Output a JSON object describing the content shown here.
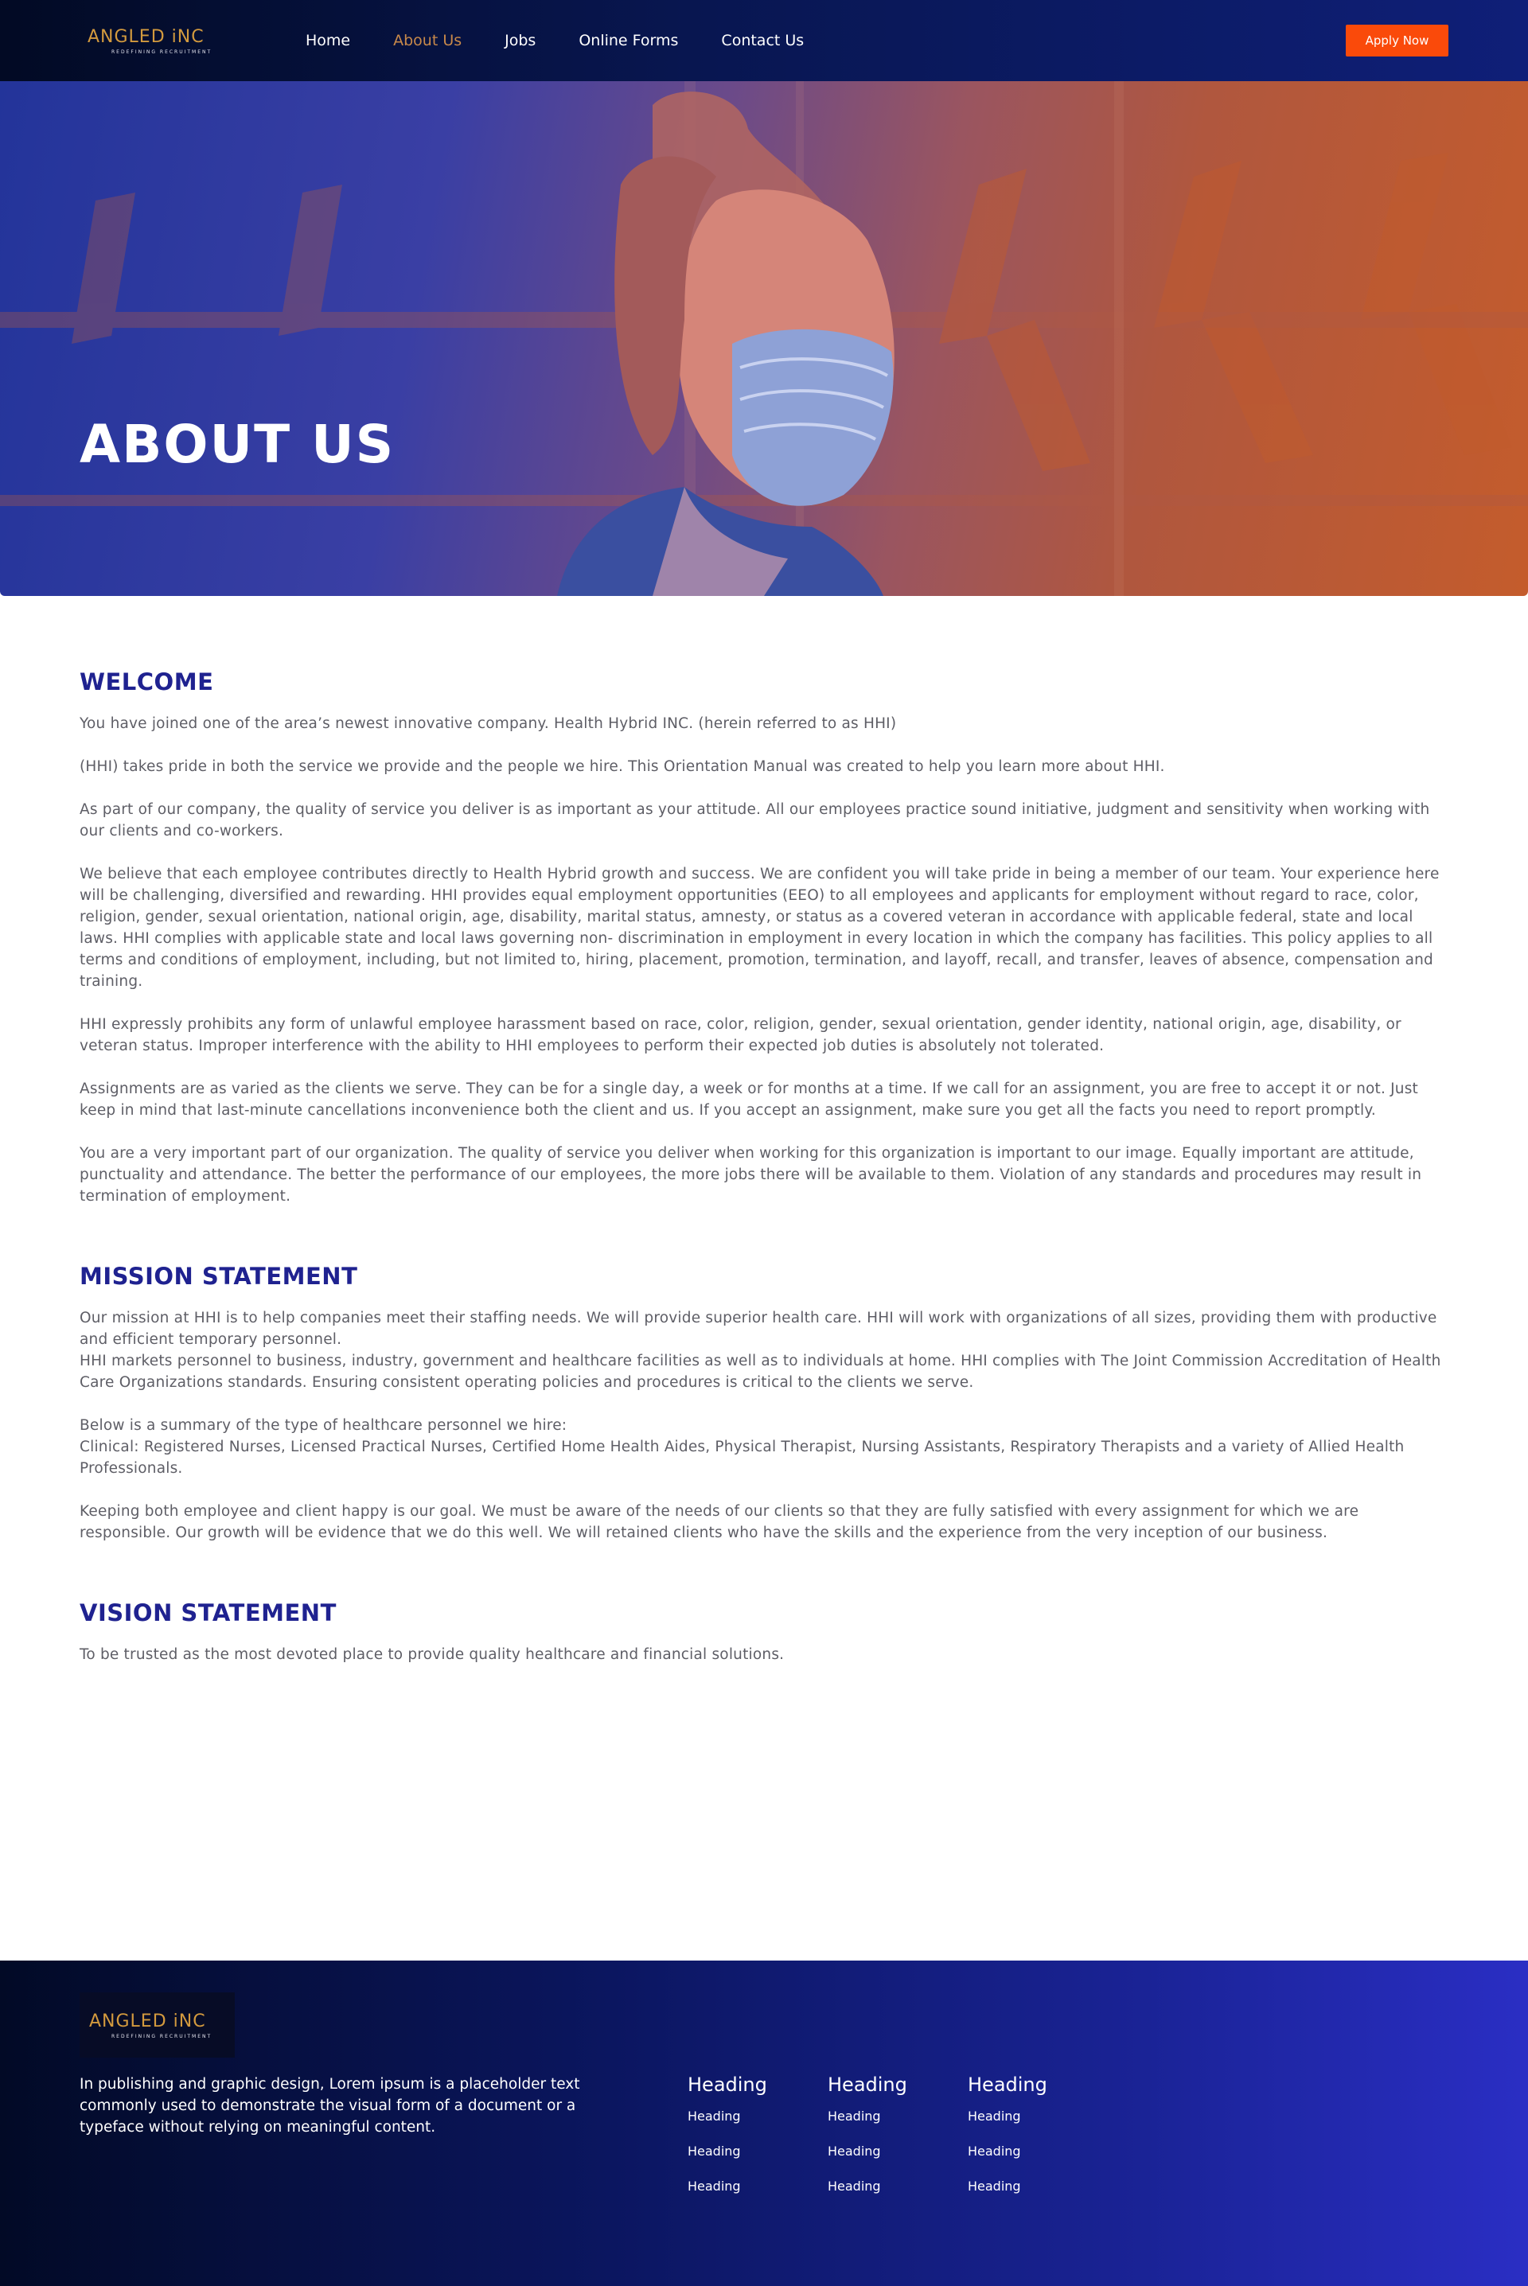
{
  "brand": {
    "name": "ANGLED iNC",
    "tagline": "REDEFINING RECRUITMENT",
    "accent_color": "#d39a3e"
  },
  "nav": {
    "links": [
      {
        "label": "Home"
      },
      {
        "label": "About Us",
        "active": true
      },
      {
        "label": "Jobs"
      },
      {
        "label": "Online Forms"
      },
      {
        "label": "Contact Us"
      }
    ],
    "apply_label": "Apply Now",
    "apply_color": "#fa4a0a"
  },
  "hero": {
    "title": "ABOUT US"
  },
  "sections": {
    "welcome": {
      "title": "WELCOME",
      "paragraphs": [
        "You have joined one of the area’s newest innovative company. Health Hybrid INC. (herein referred to as HHI)",
        "(HHI) takes pride in both the service we provide and the people we hire. This Orientation Manual was created to help you learn more about HHI.",
        "As part of our company, the quality of service you deliver is as important as your attitude. All our employees practice sound initiative, judgment and sensitivity when working with our clients and co-workers.",
        "We believe that each employee contributes directly to Health Hybrid growth and success. We are confident you will take pride in being a member of our team. Your experience here will be challenging, diversified and rewarding. HHI provides equal employment opportunities (EEO) to all employees and applicants for employment without regard to race, color, religion, gender, sexual orientation, national origin, age, disability, marital status, amnesty, or status as a covered veteran in accordance with applicable federal, state and local laws. HHI complies with applicable state and local laws governing non- discrimination in employment in every location in which the company has facilities. This policy applies to all terms and conditions of employment, including, but not limited to, hiring, placement, promotion, termination, and layoff, recall, and transfer, leaves of absence, compensation and training.",
        "HHI expressly prohibits any form of unlawful employee harassment based on race, color, religion, gender, sexual orientation, gender identity, national origin, age, disability, or veteran status. Improper interference with the ability to HHI employees to perform their expected job duties is absolutely not tolerated.",
        "Assignments are as varied as the clients we serve. They can be for a single day, a week or for months at a time. If we call for an assignment, you are free to accept it or not. Just keep in mind that last-minute cancellations inconvenience both the client and us. If you accept an assignment, make sure you get all the facts you need to report promptly.",
        "You are a very important part of our organization. The quality of service you deliver when working for this organization is important to our image. Equally important are attitude, punctuality and attendance. The better the performance of our employees, the more jobs there will be available to them. Violation of any standards and procedures may result in termination of employment."
      ]
    },
    "mission": {
      "title": "MISSION STATEMENT",
      "paragraphs": [
        "Our mission at HHI is to help companies meet their staffing needs. We will provide superior health care. HHI will work with organizations of all sizes, providing them with productive and efficient temporary personnel.",
        "HHI markets personnel to business, industry, government and healthcare facilities as well as to individuals at home. HHI complies with The Joint Commission Accreditation of Health Care Organizations standards. Ensuring consistent operating policies and procedures is critical to the clients we serve.",
        "Below is a summary of the type of healthcare personnel we hire:",
        "Clinical: Registered Nurses, Licensed Practical Nurses, Certified Home Health Aides, Physical Therapist, Nursing Assistants, Respiratory Therapists and a variety of Allied Health Professionals.",
        "Keeping both employee and client happy is our goal. We must be aware of the needs of our clients so that they are fully satisfied with every assignment for which we are responsible. Our growth will be evidence that we do this well. We will retained clients who have the skills and the experience from the very inception of our business."
      ]
    },
    "vision": {
      "title": "VISION STATEMENT",
      "paragraphs": [
        "To be trusted as the most devoted place to provide quality healthcare and financial solutions."
      ]
    }
  },
  "footer": {
    "description": "In publishing and graphic design, Lorem ipsum is a placeholder text commonly used to demonstrate the visual form of a document or a typeface without relying on meaningful content.",
    "columns": [
      {
        "heading": "Heading",
        "links": [
          "Heading",
          "Heading",
          "Heading"
        ]
      },
      {
        "heading": "Heading",
        "links": [
          "Heading",
          "Heading",
          "Heading"
        ]
      },
      {
        "heading": "Heading",
        "links": [
          "Heading",
          "Heading",
          "Heading"
        ]
      }
    ]
  }
}
